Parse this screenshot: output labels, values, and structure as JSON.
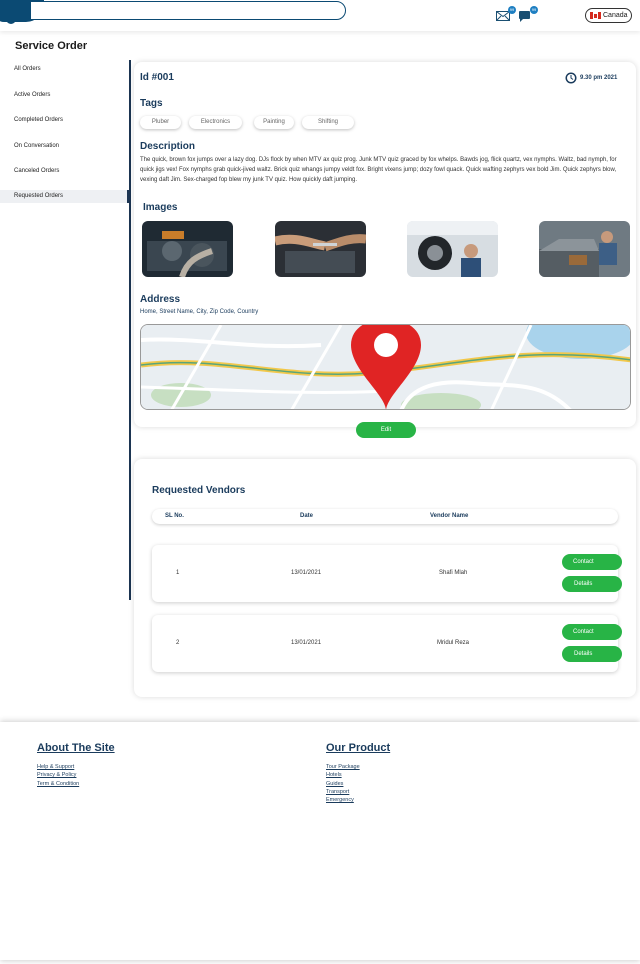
{
  "header": {
    "search_placeholder": "",
    "mail_badge": "99",
    "notif_badge": "99",
    "country": "Canada"
  },
  "page_title": "Service Order",
  "sidebar": {
    "items": [
      {
        "label": "All Orders"
      },
      {
        "label": "Active Orders"
      },
      {
        "label": "Completed Orders"
      },
      {
        "label": "On Conversation"
      },
      {
        "label": "Canceled Orders"
      },
      {
        "label": "Requested Orders"
      }
    ],
    "active_index": 5
  },
  "order": {
    "id": "Id #001",
    "time": "9.30 pm 2021",
    "tags_title": "Tags",
    "tags": [
      "Pluber",
      "Electronics",
      "Painting",
      "Shifting"
    ],
    "description_title": "Description",
    "description": "The quick, brown fox jumps over a lazy dog. DJs flock by when MTV ax quiz prog. Junk MTV quiz graced by fox whelps. Bawds jog, flick quartz, vex nymphs. Waltz, bad nymph, for quick jigs vex! Fox nymphs grab quick-jived waltz. Brick quiz whangs jumpy veldt fox. Bright vixens jump; dozy fowl quack. Quick wafting zephyrs vex bold Jim. Quick zephyrs blow, vexing daft Jim. Sex-charged fop blew my junk TV quiz. How quickly daft jumping.",
    "images_title": "Images",
    "address_title": "Address",
    "address": "Home, Street Name, City, Zip Code, Country",
    "edit_label": "Edit"
  },
  "vendors": {
    "title": "Requested Vendors",
    "columns": [
      "SL No.",
      "Date",
      "Vendor Name"
    ],
    "rows": [
      {
        "sl": "1",
        "date": "13/01/2021",
        "name": "Shafi Mlah",
        "contact": "Contact",
        "details": "Details"
      },
      {
        "sl": "2",
        "date": "13/01/2021",
        "name": "Mridul Reza",
        "contact": "Contact",
        "details": "Details"
      }
    ]
  },
  "footer": {
    "about_title": "About The Site",
    "about_links": [
      "Help & Support",
      "Privacy & Policy",
      "Term & Condition"
    ],
    "product_title": "Our Product",
    "product_links": [
      "Tour Package",
      "Hotels",
      "Guides",
      "Transport",
      "Emergency"
    ]
  },
  "colors": {
    "primary": "#0b4a73",
    "accent_green": "#28b446",
    "heading": "#1a3b5c",
    "pin_red": "#e02424"
  }
}
